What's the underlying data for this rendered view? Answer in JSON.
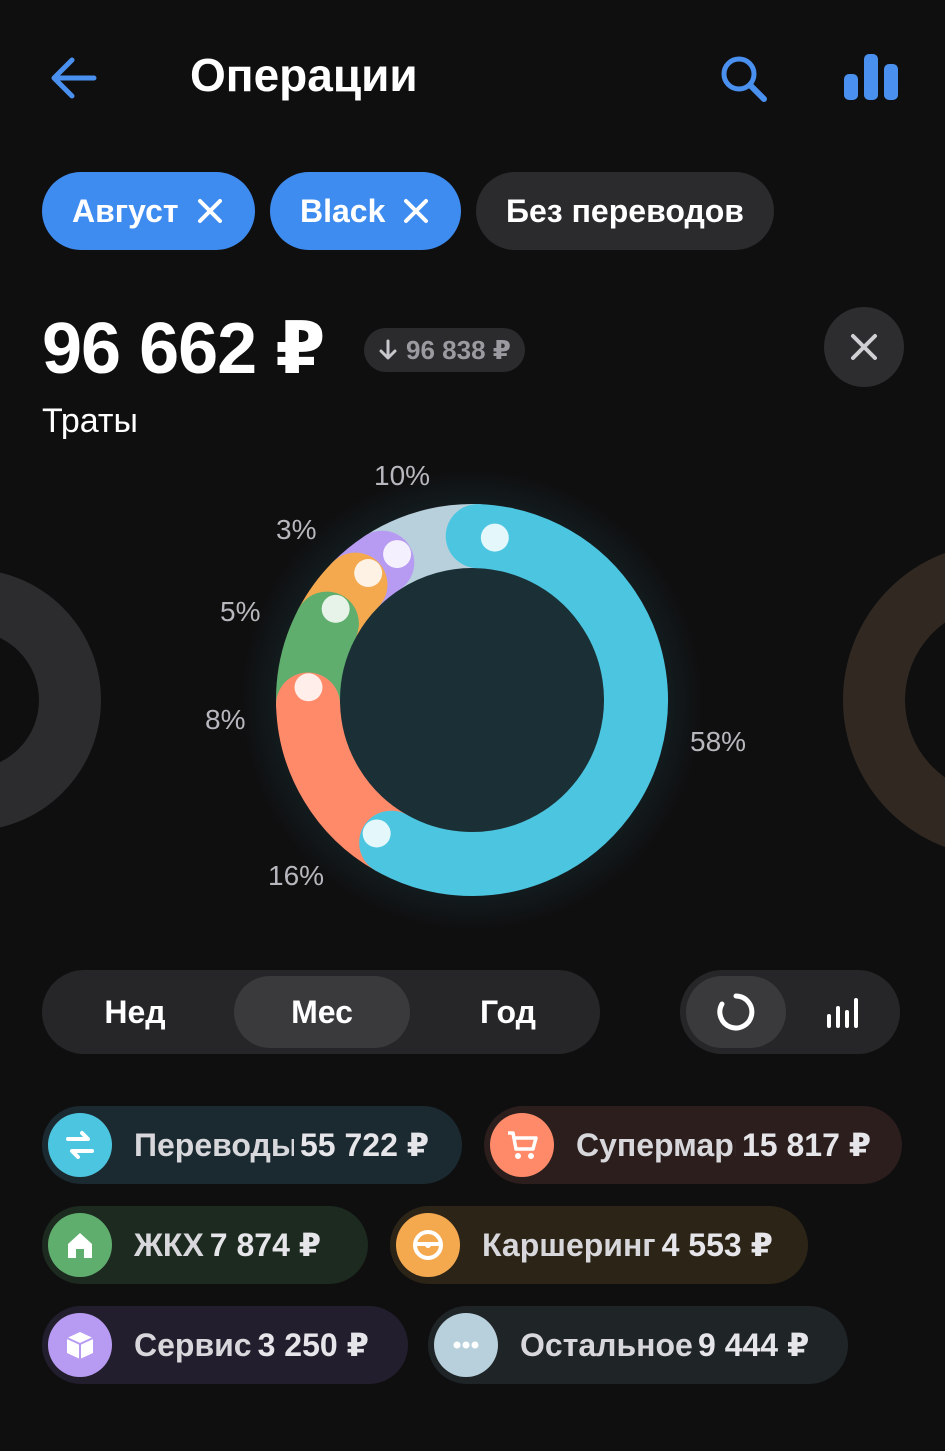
{
  "header": {
    "title": "Операции",
    "back_icon": "arrow-left-icon",
    "search_icon": "search-icon",
    "analytics_icon": "bar-chart-icon"
  },
  "filters": [
    {
      "label": "Август",
      "active": true
    },
    {
      "label": "Black",
      "active": true
    },
    {
      "label": "Без переводов",
      "active": false
    }
  ],
  "summary": {
    "total": "96 662 ₽",
    "previous": "96 838 ₽",
    "caption": "Траты"
  },
  "chart_data": {
    "type": "pie",
    "labels": [
      "Переводы",
      "Супермаркеты",
      "ЖКХ",
      "Каршеринг",
      "Сервис",
      "Остальное"
    ],
    "values": [
      55722,
      15817,
      7874,
      4553,
      3250,
      9444
    ],
    "percent_labels": [
      "58%",
      "16%",
      "8%",
      "5%",
      "3%",
      "10%"
    ],
    "colors": [
      "#4cc6e0",
      "#ff8a6a",
      "#5fae6e",
      "#f5a94f",
      "#b79bf2",
      "#b8cfdc"
    ],
    "donut": true
  },
  "period": {
    "options": [
      "Нед",
      "Мес",
      "Год"
    ],
    "selected": "Мес"
  },
  "view_toggle": {
    "options": [
      "donut-chart-icon",
      "bar-chart-icon"
    ],
    "selected": "donut-chart-icon"
  },
  "legend": [
    {
      "label": "Переводы",
      "amount": "55 722 ₽",
      "color": "#4cc6e0",
      "icon": "transfer-icon"
    },
    {
      "label": "Супермаркеты",
      "amount": "15 817 ₽",
      "color": "#ff8a6a",
      "icon": "cart-icon"
    },
    {
      "label": "ЖКХ",
      "amount": "7 874 ₽",
      "color": "#5fae6e",
      "icon": "house-icon"
    },
    {
      "label": "Каршеринг",
      "amount": "4 553 ₽",
      "color": "#f5a94f",
      "icon": "steering-wheel-icon"
    },
    {
      "label": "Сервис",
      "amount": "3 250 ₽",
      "color": "#b79bf2",
      "icon": "box-icon"
    },
    {
      "label": "Остальное",
      "amount": "9 444 ₽",
      "color": "#b8cfdc",
      "icon": "more-icon"
    }
  ]
}
